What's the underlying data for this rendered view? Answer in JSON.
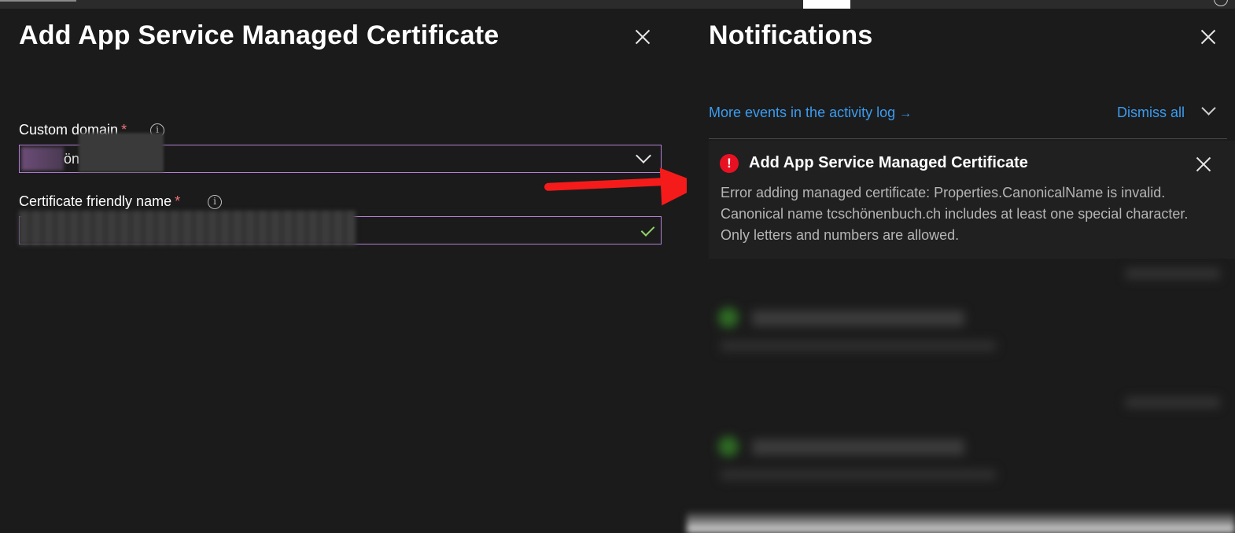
{
  "left_panel": {
    "title": "Add App Service Managed Certificate",
    "close_icon": "close-icon",
    "custom_domain": {
      "label": "Custom domain",
      "required_mark": "*",
      "info_icon": "info-icon",
      "value": "ön",
      "icon": "chevron-down-icon"
    },
    "friendly_name": {
      "label": "Certificate friendly name",
      "required_mark": "*",
      "info_icon": "info-icon",
      "icon": "checkmark-icon"
    }
  },
  "info_glyph": "i",
  "notifications": {
    "title": "Notifications",
    "close_icon": "close-icon",
    "activity_link": "More events in the activity log",
    "activity_arrow": "→",
    "dismiss_all": "Dismiss all",
    "expand_icon": "chevron-down-icon",
    "items": [
      {
        "status": "error",
        "status_icon": "error-icon",
        "status_glyph": "!",
        "title": "Add App Service Managed Certificate",
        "body": [
          "Error adding managed certificate: Properties.CanonicalName is invalid.",
          "Canonical name tcschönenbuch.ch includes at least one special character.",
          "Only letters and numbers are allowed."
        ],
        "close_icon": "close-icon"
      }
    ]
  },
  "colors": {
    "background": "#1b1b1b",
    "link": "#3b9cf0",
    "error": "#e81123",
    "input_border": "#b480d6",
    "required": "#f1707b",
    "check": "#8fd26a",
    "annotation_arrow": "#f51b1b"
  }
}
